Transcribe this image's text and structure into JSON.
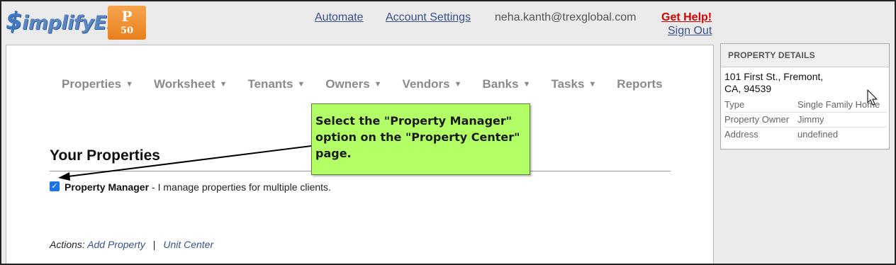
{
  "header": {
    "logo_text": "implifyEm",
    "logo_symbol": "$",
    "plan_badge": {
      "letter": "P",
      "number": "50"
    },
    "links": {
      "automate": "Automate",
      "account_settings": "Account Settings",
      "email": "neha.kanth@trexglobal.com",
      "get_help": "Get Help!",
      "sign_out": "Sign Out"
    }
  },
  "nav": {
    "items": [
      {
        "label": "Properties",
        "dropdown": true
      },
      {
        "label": "Worksheet",
        "dropdown": true
      },
      {
        "label": "Tenants",
        "dropdown": true
      },
      {
        "label": "Owners",
        "dropdown": true
      },
      {
        "label": "Vendors",
        "dropdown": true
      },
      {
        "label": "Banks",
        "dropdown": true
      },
      {
        "label": "Tasks",
        "dropdown": true
      },
      {
        "label": "Reports",
        "dropdown": false
      }
    ]
  },
  "main": {
    "title": "Your Properties",
    "property_manager": {
      "checked": true,
      "label": "Property Manager",
      "description": "- I manage properties for multiple clients."
    },
    "actions": {
      "prefix": "Actions:",
      "add_property": "Add Property",
      "separator": "|",
      "unit_center": "Unit Center"
    }
  },
  "callout": {
    "text": "Select the \"Property Manager\" option on the \"Property Center\" page."
  },
  "property_details": {
    "heading": "PROPERTY DETAILS",
    "address_line1": "101 First St., Fremont,",
    "address_line2": "CA, 94539",
    "rows": [
      {
        "key": "Type",
        "value": "Single Family Home"
      },
      {
        "key": "Property Owner",
        "value": "Jimmy"
      },
      {
        "key": "Address",
        "value": "undefined"
      }
    ]
  },
  "colors": {
    "link": "#37528a",
    "help": "#d40000",
    "callout_bg": "#b3ff66",
    "badge": "#e8801e",
    "nav_text": "#8a8a8a"
  }
}
